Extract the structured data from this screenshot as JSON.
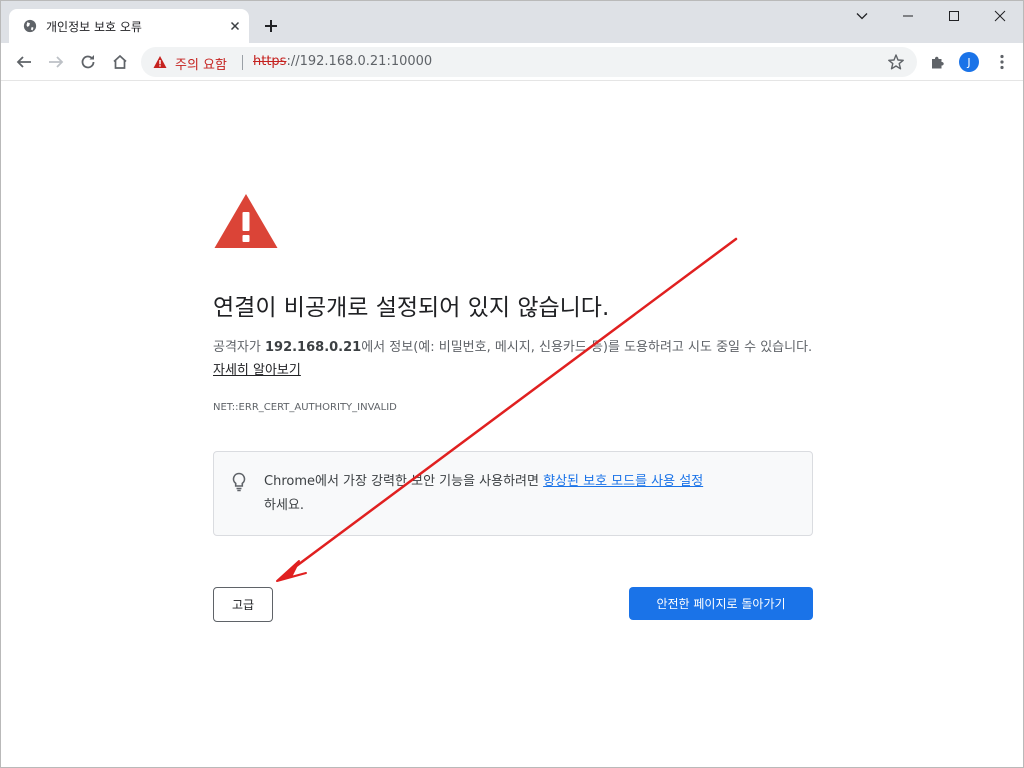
{
  "tab": {
    "title": "개인정보 보호 오류",
    "favicon": "globe-icon"
  },
  "omnibox": {
    "warning_label": "주의 요함",
    "url_scheme": "https",
    "url_rest": "://192.168.0.21:10000"
  },
  "profile": {
    "initial": "J",
    "color": "#1a73e8"
  },
  "interstitial": {
    "heading": "연결이 비공개로 설정되어 있지 않습니다.",
    "desc_prefix": "공격자가 ",
    "desc_host": "192.168.0.21",
    "desc_suffix": "에서 정보(예: 비밀번호, 메시지, 신용카드 등)를 도용하려고 시도 중일 수 있습니다. ",
    "learn_more": "자세히 알아보기",
    "error_code": "NET::ERR_CERT_AUTHORITY_INVALID",
    "safe_prefix": "Chrome에서 가장 강력한 보안 기능을 사용하려면 ",
    "safe_link": "향상된 보호 모드를 사용 설정",
    "safe_suffix": "하세요.",
    "advanced_label": "고급",
    "back_label": "안전한 페이지로 돌아가기"
  },
  "colors": {
    "warning_red": "#db4437",
    "primary_blue": "#1a73e8",
    "annotation_arrow": "#e02020"
  }
}
